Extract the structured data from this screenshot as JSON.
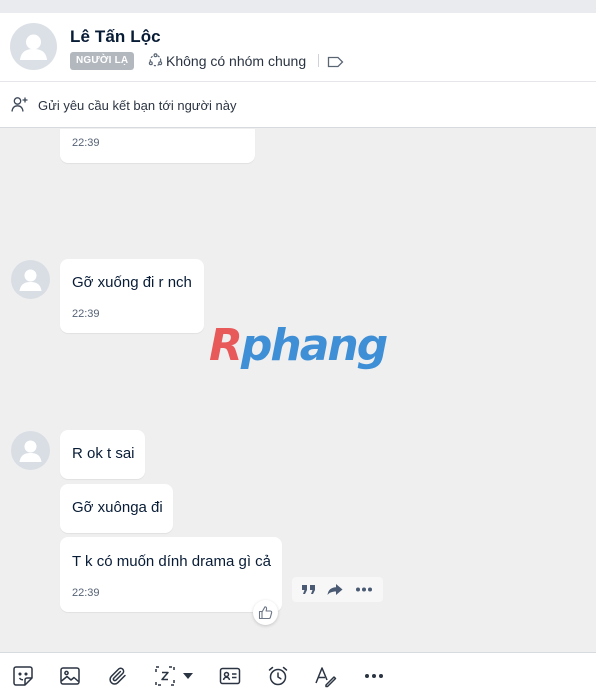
{
  "header": {
    "name": "Lê Tấn Lộc",
    "badge": "NGƯỜI LẠ",
    "groups_label": "Không có nhóm chung"
  },
  "friend_request": {
    "label": "Gửi yêu cầu kết bạn tới người này"
  },
  "messages": {
    "m0": {
      "time": "22:39"
    },
    "m1": {
      "text": "Gỡ xuống đi r nch",
      "time": "22:39"
    },
    "m2": {
      "text": "R ok t sai"
    },
    "m3": {
      "text": "Gỡ xuônga đi"
    },
    "m4": {
      "text": "T k có muốn dính drama gì cả",
      "time": "22:39"
    }
  },
  "watermark": {
    "first": "R",
    "rest": "phang"
  },
  "colors": {
    "accent": "#3f8fd6",
    "badge_bg": "#b3b8bf",
    "chat_bg": "#efefef",
    "watermark_red": "#e8595a"
  },
  "icons": {
    "message_actions": [
      "quote-icon",
      "forward-icon",
      "more-icon"
    ],
    "toolbar": [
      "sticker-icon",
      "image-icon",
      "attachment-icon",
      "screenshot-icon",
      "contact-card-icon",
      "reminder-icon",
      "text-format-icon",
      "more-options-icon"
    ]
  }
}
